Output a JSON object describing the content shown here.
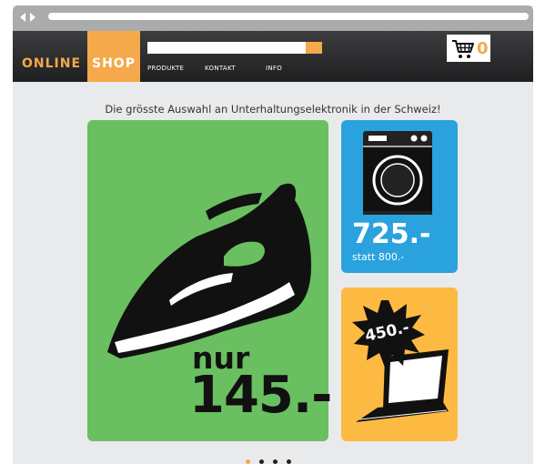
{
  "logo": {
    "part1": "ONLINE",
    "part2": "SHOP"
  },
  "menu": [
    "PRODUKTE",
    "KONTAKT",
    "INFO"
  ],
  "cart": {
    "count": "0"
  },
  "tagline": "Die grösste Auswahl an Unterhaltungselektronik in der Schweiz!",
  "offers": {
    "iron": {
      "prefix": "nur",
      "price": "145.-"
    },
    "washer": {
      "price": "725.-",
      "old_price": "statt 800.-"
    },
    "laptop": {
      "price": "450.-"
    }
  },
  "colors": {
    "accent": "#f5a94a",
    "green": "#6abf60",
    "blue": "#2aa2de",
    "yellow": "#fdba42"
  },
  "icons": [
    "cart-icon",
    "back-arrow-icon",
    "forward-arrow-icon"
  ],
  "carousel": {
    "count": 4,
    "active": 1
  }
}
